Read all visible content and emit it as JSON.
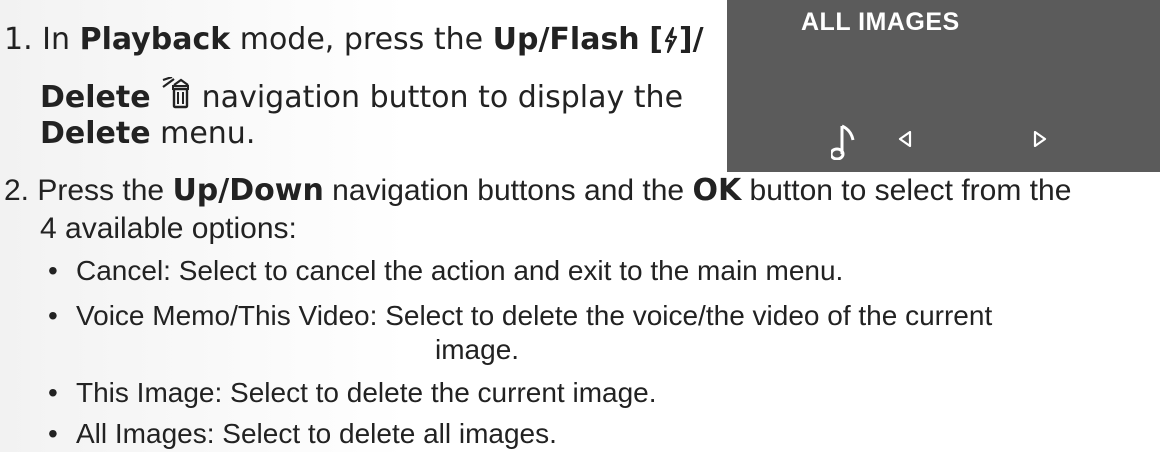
{
  "step1": {
    "number": "1.",
    "t1": "In ",
    "b1": "Playback",
    "t2": " mode, press the ",
    "b2": "Up/Flash",
    "b3": "[",
    "b4": "]/",
    "b5": "Delete",
    "t3": " navigation button to display the",
    "b6": "Delete",
    "t4": " menu."
  },
  "lcd": {
    "title": "ALL IMAGES",
    "icons": [
      "music-note-icon",
      "left-arrow-icon",
      "right-arrow-icon"
    ]
  },
  "step2": {
    "number": "2.",
    "t1": " Press the ",
    "b1": "Up/Down",
    "t2": " navigation buttons and the ",
    "b2": "OK",
    "t3": " button to select from the",
    "line2": "4 available options:"
  },
  "bullets": {
    "cancel": "Cancel: Select to cancel the action and exit to the main menu.",
    "voice_line1": "Voice Memo/This Video: Select to delete the voice/the video of the current",
    "voice_line2": "image.",
    "this_image": "This Image: Select to delete the current image.",
    "all_images": "All Images: Select to delete all images."
  },
  "bullet_char": "•"
}
